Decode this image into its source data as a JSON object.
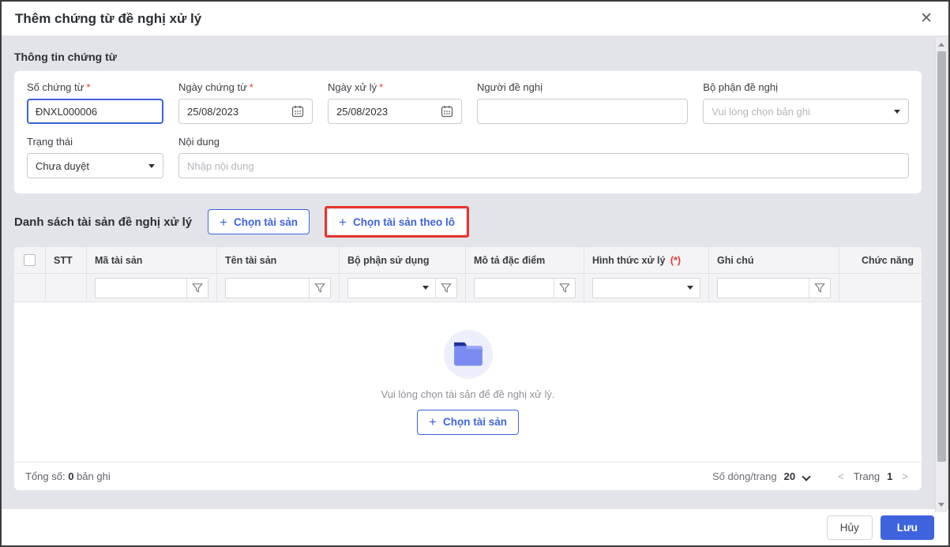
{
  "dialog": {
    "title": "Thêm chứng từ đề nghị xử lý",
    "close_icon": "✕"
  },
  "info": {
    "heading": "Thông tin chứng từ",
    "required_mark": "*",
    "fields": {
      "document_number": {
        "label": "Số chứng từ",
        "value": "ĐNXL000006"
      },
      "document_date": {
        "label": "Ngày chứng từ",
        "value": "25/08/2023"
      },
      "processing_date": {
        "label": "Ngày xử lý",
        "value": "25/08/2023"
      },
      "requester": {
        "label": "Người đề nghị",
        "value": ""
      },
      "requesting_department": {
        "label": "Bộ phận đề nghị",
        "placeholder": "Vui lòng chọn bản ghi"
      },
      "status": {
        "label": "Trạng thái",
        "value": "Chưa duyệt"
      },
      "content": {
        "label": "Nội dung",
        "placeholder": "Nhập nội dung"
      }
    }
  },
  "assets": {
    "heading": "Danh sách tài sản đề nghị xử lý",
    "plus_icon": "+",
    "select_button": "Chọn tài sản",
    "select_batch_button": "Chọn tài sản theo lô"
  },
  "table": {
    "columns": [
      {
        "label": "STT"
      },
      {
        "label": "Mã tài sản"
      },
      {
        "label": "Tên tài sản"
      },
      {
        "label": "Bộ phận sử dụng"
      },
      {
        "label": "Mô tả đặc điểm"
      },
      {
        "label": "Hình thức xử lý",
        "required_mark": "(*)"
      },
      {
        "label": "Ghi chú"
      },
      {
        "label": "Chức năng"
      }
    ],
    "empty": {
      "message": "Vui lòng chọn tài sản để đề nghị xử lý.",
      "plus_icon": "+",
      "button": "Chọn tài sản"
    },
    "summary": {
      "label": "Tổng số:",
      "value": "0",
      "unit": "bản ghi"
    },
    "pagination": {
      "rows_label": "Số dòng/trang",
      "rows_value": "20",
      "prev": "<",
      "page_label": "Trang",
      "page": "1",
      "next": ">"
    }
  },
  "footer": {
    "cancel": "Hủy",
    "save": "Lưu"
  },
  "colors": {
    "accent": "#3e63dd",
    "highlight_box": "#e5352b",
    "required": "#e53935"
  }
}
